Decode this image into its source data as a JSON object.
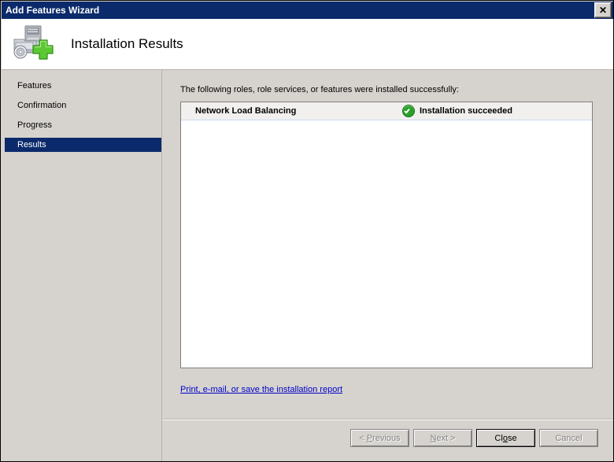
{
  "window": {
    "title": "Add Features Wizard",
    "close_label": "✕",
    "close_icon": "close-icon"
  },
  "header": {
    "title": "Installation Results",
    "icon": "server-add-feature-icon"
  },
  "sidebar": {
    "items": [
      {
        "label": "Features",
        "selected": false
      },
      {
        "label": "Confirmation",
        "selected": false
      },
      {
        "label": "Progress",
        "selected": false
      },
      {
        "label": "Results",
        "selected": true
      }
    ]
  },
  "main": {
    "intro_text": "The following roles, role services, or features were installed successfully:",
    "results": [
      {
        "name": "Network Load Balancing",
        "status": "Installation succeeded",
        "status_icon": "success-check-icon"
      }
    ],
    "report_link": "Print, e-mail, or save the installation report"
  },
  "buttons": [
    {
      "label_pre": "< ",
      "accel": "P",
      "label_post": "revious",
      "disabled": true,
      "default": false,
      "name": "previous-button"
    },
    {
      "label_pre": "",
      "accel": "N",
      "label_post": "ext >",
      "disabled": true,
      "default": false,
      "name": "next-button"
    },
    {
      "label_pre": "Cl",
      "accel": "o",
      "label_post": "se",
      "disabled": false,
      "default": true,
      "name": "close-button"
    },
    {
      "label_pre": "Cancel",
      "accel": "",
      "label_post": "",
      "disabled": true,
      "default": false,
      "name": "cancel-button"
    }
  ],
  "colors": {
    "titlebar": "#0b2a6b",
    "selection": "#0b2a6b",
    "face": "#d6d3ce",
    "link": "#0000c8",
    "success": "#2aa02a"
  }
}
